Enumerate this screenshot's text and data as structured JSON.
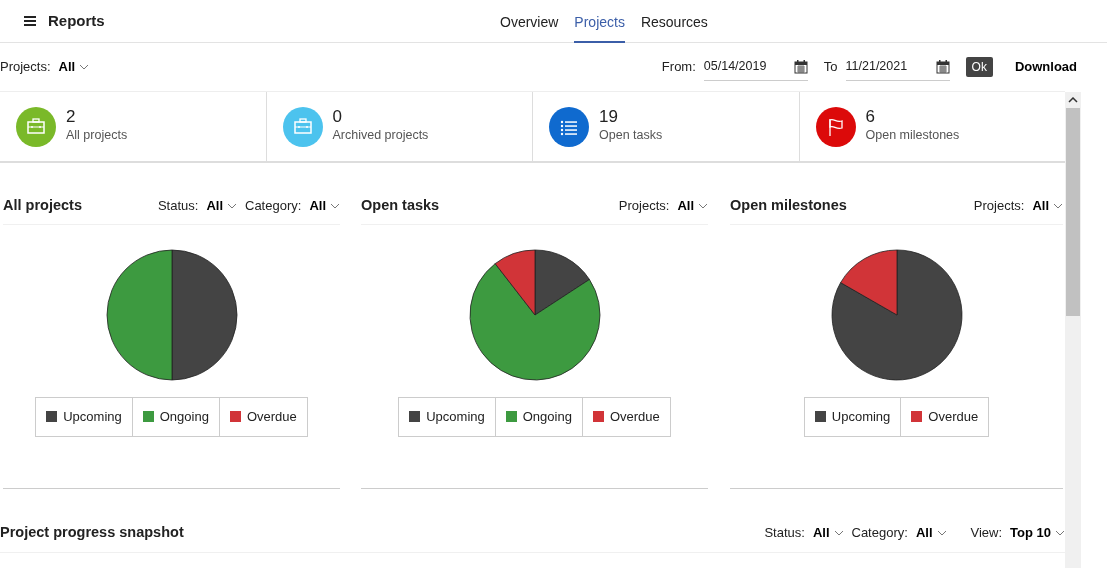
{
  "header": {
    "title": "Reports"
  },
  "tabs": [
    {
      "label": "Overview",
      "selected": false
    },
    {
      "label": "Projects",
      "selected": true
    },
    {
      "label": "Resources",
      "selected": false
    }
  ],
  "toolbar": {
    "projects_label": "Projects:",
    "projects_value": "All",
    "from_label": "From:",
    "from_value": "05/14/2019",
    "to_label": "To",
    "to_value": "11/21/2021",
    "ok": "Ok",
    "download": "Download"
  },
  "kpis": [
    {
      "value": "2",
      "label": "All projects",
      "color": "#7ab929",
      "kind": "briefcase"
    },
    {
      "value": "0",
      "label": "Archived projects",
      "color": "#4cc3ee",
      "kind": "briefcase"
    },
    {
      "value": "19",
      "label": "Open tasks",
      "color": "#0f6acf",
      "kind": "list"
    },
    {
      "value": "6",
      "label": "Open milestones",
      "color": "#dc0a0a",
      "kind": "flag"
    }
  ],
  "panels": [
    {
      "title": "All projects",
      "filters": [
        {
          "label": "Status:",
          "value": "All"
        },
        {
          "label": "Category:",
          "value": "All"
        }
      ],
      "legend": [
        {
          "color": "#444444"
        },
        {
          "color": "#3d9a40"
        },
        {
          "color": "#d13438"
        }
      ],
      "chart_data": {
        "type": "pie",
        "categories": [
          "Upcoming",
          "Ongoing",
          "Overdue"
        ],
        "values": [
          50,
          50,
          0
        ]
      }
    },
    {
      "title": "Open tasks",
      "filters": [
        {
          "label": "Projects:",
          "value": "All"
        }
      ],
      "legend": [
        {
          "color": "#444444"
        },
        {
          "color": "#3d9a40"
        },
        {
          "color": "#d13438"
        }
      ],
      "chart_data": {
        "type": "pie",
        "categories": [
          "Upcoming",
          "Ongoing",
          "Overdue"
        ],
        "values": [
          15.8,
          73.7,
          10.5
        ]
      }
    },
    {
      "title": "Open milestones",
      "filters": [
        {
          "label": "Projects:",
          "value": "All"
        }
      ],
      "legend": [
        {
          "color": "#444444"
        },
        {
          "color": "#d13438"
        }
      ],
      "chart_data": {
        "type": "pie",
        "categories": [
          "Upcoming",
          "Overdue"
        ],
        "values": [
          83.3,
          16.7
        ]
      }
    }
  ],
  "snapshot": {
    "title": "Project progress snapshot",
    "filters": [
      {
        "label": "Status:",
        "value": "All"
      },
      {
        "label": "Category:",
        "value": "All"
      },
      {
        "label": "View:",
        "value": "Top 10"
      }
    ]
  }
}
